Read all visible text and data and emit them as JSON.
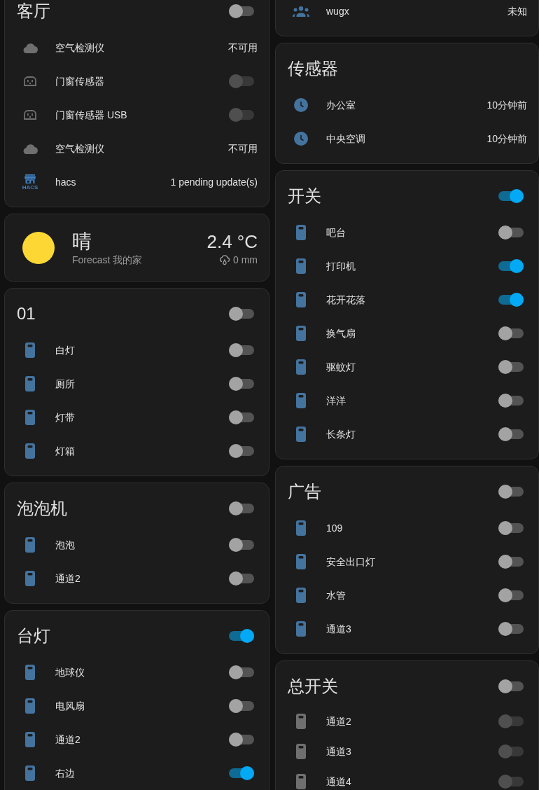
{
  "columns": [
    {
      "cards": [
        {
          "kind": "entities",
          "title": "客厅",
          "header_toggle": {
            "on": false
          },
          "rows": [
            {
              "kind": "air",
              "name": "空气检测仪",
              "value": "不可用",
              "disabled": true
            },
            {
              "kind": "outlet",
              "name": "门窗传感器",
              "on": false,
              "disabled": true
            },
            {
              "kind": "outlet",
              "name": "门窗传感器 USB",
              "on": false,
              "disabled": true
            },
            {
              "kind": "air",
              "name": "空气检测仪",
              "value": "不可用",
              "disabled": true
            },
            {
              "kind": "update",
              "name": "hacs",
              "logo": "HACS",
              "value": "1 pending update(s)",
              "disabled": false
            }
          ]
        },
        {
          "kind": "weather",
          "condition": "晴",
          "subtitle": "Forecast 我的家",
          "temperature": "2.4 °C",
          "precipitation": "0 mm"
        },
        {
          "kind": "entities",
          "title": "01",
          "header_toggle": {
            "on": false
          },
          "rows": [
            {
              "kind": "switch",
              "name": "白灯",
              "on": false,
              "disabled": false
            },
            {
              "kind": "switch",
              "name": "厕所",
              "on": false,
              "disabled": false
            },
            {
              "kind": "switch",
              "name": "灯带",
              "on": false,
              "disabled": false
            },
            {
              "kind": "switch",
              "name": "灯箱",
              "on": false,
              "disabled": false
            }
          ]
        },
        {
          "kind": "entities",
          "title": "泡泡机",
          "header_toggle": {
            "on": false
          },
          "rows": [
            {
              "kind": "switch",
              "name": "泡泡",
              "on": false,
              "disabled": false
            },
            {
              "kind": "switch",
              "name": "通道2",
              "on": false,
              "disabled": false
            }
          ]
        },
        {
          "kind": "entities",
          "title": "台灯",
          "header_toggle": {
            "on": true
          },
          "rows": [
            {
              "kind": "switch",
              "name": "地球仪",
              "on": false,
              "disabled": false
            },
            {
              "kind": "switch",
              "name": "电风扇",
              "on": false,
              "disabled": false
            },
            {
              "kind": "switch",
              "name": "通道2",
              "on": false,
              "disabled": false
            },
            {
              "kind": "switch",
              "name": "右边",
              "on": true,
              "disabled": false
            }
          ]
        }
      ]
    },
    {
      "cards": [
        {
          "kind": "entities",
          "rows": [
            {
              "kind": "group",
              "name": "wugx",
              "value": "未知",
              "disabled": false
            }
          ]
        },
        {
          "kind": "entities",
          "title": "传感器",
          "rows": [
            {
              "kind": "time",
              "name": "办公室",
              "value": "10分钟前",
              "disabled": false
            },
            {
              "kind": "time",
              "name": "中央空调",
              "value": "10分钟前",
              "disabled": false
            }
          ]
        },
        {
          "kind": "entities",
          "title": "开关",
          "header_toggle": {
            "on": true
          },
          "rows": [
            {
              "kind": "switch",
              "name": "吧台",
              "on": false,
              "disabled": false
            },
            {
              "kind": "switch",
              "name": "打印机",
              "on": true,
              "disabled": false
            },
            {
              "kind": "switch",
              "name": "花开花落",
              "on": true,
              "disabled": false
            },
            {
              "kind": "switch",
              "name": "换气扇",
              "on": false,
              "disabled": false
            },
            {
              "kind": "switch",
              "name": "驱蚊灯",
              "on": false,
              "disabled": false
            },
            {
              "kind": "switch",
              "name": "洋洋",
              "on": false,
              "disabled": false
            },
            {
              "kind": "switch",
              "name": "长条灯",
              "on": false,
              "disabled": false
            }
          ]
        },
        {
          "kind": "entities",
          "title": "广告",
          "header_toggle": {
            "on": false
          },
          "rows": [
            {
              "kind": "switch",
              "name": "109",
              "on": false,
              "disabled": false
            },
            {
              "kind": "switch",
              "name": "安全出口灯",
              "on": false,
              "disabled": false
            },
            {
              "kind": "switch",
              "name": "水管",
              "on": false,
              "disabled": false
            },
            {
              "kind": "switch",
              "name": "通道3",
              "on": false,
              "disabled": false
            }
          ]
        },
        {
          "kind": "entities",
          "title": "总开关",
          "header_toggle": {
            "on": false
          },
          "rows": [
            {
              "kind": "switch",
              "name": "通道2",
              "on": false,
              "disabled": true
            },
            {
              "kind": "switch",
              "name": "通道3",
              "on": false,
              "disabled": true
            },
            {
              "kind": "switch",
              "name": "通道4",
              "on": false,
              "disabled": true
            }
          ]
        }
      ]
    }
  ]
}
